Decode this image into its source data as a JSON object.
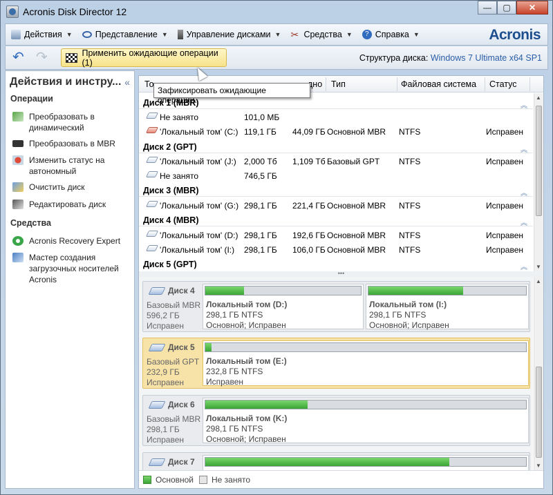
{
  "window": {
    "title": "Acronis Disk Director 12",
    "buttons": [
      "—",
      "▢",
      "✕"
    ]
  },
  "menu": {
    "items": [
      "Действия",
      "Представление",
      "Управление дисками",
      "Средства",
      "Справка"
    ],
    "logo": "Acronis"
  },
  "toolbar": {
    "apply_label": "Применить ожидающие операции (1)",
    "structure_label": "Структура диска:",
    "structure_value": "Windows 7 Ultimate x64 SP1"
  },
  "tooltip": "Зафиксировать ожидающие операции.",
  "left_panel": {
    "title": "Действия и инстру...",
    "collapse": "«",
    "operations_title": "Операции",
    "operations": [
      "Преобразовать в динамический",
      "Преобразовать в MBR",
      "Изменить статус на автономный",
      "Очистить диск",
      "Редактировать диск"
    ],
    "tools_title": "Средства",
    "tools": [
      "Acronis Recovery Expert",
      "Мастер создания загрузочных носителей Acronis"
    ]
  },
  "table": {
    "headers": {
      "tom": "То",
      "free": "дно",
      "type": "Тип",
      "fs": "Файловая система",
      "status": "Статус"
    },
    "groups": [
      {
        "name": "Диск 1 (MBR)",
        "rows": [
          {
            "volume": "Не занято",
            "capacity": "101,0 МБ",
            "free": "",
            "type": "",
            "fs": "",
            "status": ""
          },
          {
            "volume": "'Локальный том' (C:)",
            "capacity": "119,1 ГБ",
            "free": "44,09 ГБ",
            "type": "Основной MBR",
            "fs": "NTFS",
            "status": "Исправен"
          }
        ]
      },
      {
        "name": "Диск 2 (GPT)",
        "rows": [
          {
            "volume": "'Локальный том' (J:)",
            "capacity": "2,000 Тб",
            "free": "1,109 Тб",
            "type": "Базовый GPT",
            "fs": "NTFS",
            "status": "Исправен"
          },
          {
            "volume": "Не занято",
            "capacity": "746,5 ГБ",
            "free": "",
            "type": "",
            "fs": "",
            "status": ""
          }
        ]
      },
      {
        "name": "Диск 3 (MBR)",
        "rows": [
          {
            "volume": "'Локальный том' (G:)",
            "capacity": "298,1 ГБ",
            "free": "221,4 ГБ",
            "type": "Основной MBR",
            "fs": "NTFS",
            "status": "Исправен"
          }
        ]
      },
      {
        "name": "Диск 4 (MBR)",
        "rows": [
          {
            "volume": "'Локальный том' (D:)",
            "capacity": "298,1 ГБ",
            "free": "192,6 ГБ",
            "type": "Основной MBR",
            "fs": "NTFS",
            "status": "Исправен"
          },
          {
            "volume": "'Локальный том' (I:)",
            "capacity": "298,1 ГБ",
            "free": "106,0 ГБ",
            "type": "Основной MBR",
            "fs": "NTFS",
            "status": "Исправен"
          }
        ]
      },
      {
        "name": "Диск 5 (GPT)",
        "rows": []
      }
    ]
  },
  "splitter": "•••",
  "disks": [
    {
      "name": "Диск 4",
      "kind": "Базовый MBR",
      "size": "596,2 ГБ",
      "status": "Исправен",
      "selected": false,
      "parts": [
        {
          "label": "Локальный том (D:)",
          "info": "298,1 ГБ NTFS",
          "state": "Основной; Исправен",
          "used": 0.25
        },
        {
          "label": "Локальный том (I:)",
          "info": "298,1 ГБ NTFS",
          "state": "Основной; Исправен",
          "used": 0.6
        }
      ]
    },
    {
      "name": "Диск 5",
      "kind": "Базовый GPT",
      "size": "232,9 ГБ",
      "status": "Исправен",
      "selected": true,
      "parts": [
        {
          "label": "Локальный том (E:)",
          "info": "232,8 ГБ NTFS",
          "state": "Исправен",
          "used": 0.02
        }
      ]
    },
    {
      "name": "Диск 6",
      "kind": "Базовый MBR",
      "size": "298,1 ГБ",
      "status": "Исправен",
      "selected": false,
      "parts": [
        {
          "label": "Локальный том (K:)",
          "info": "298,1 ГБ NTFS",
          "state": "Основной; Исправен",
          "used": 0.32
        }
      ]
    },
    {
      "name": "Диск 7",
      "kind": "",
      "size": "",
      "status": "",
      "selected": false,
      "parts": [
        {
          "label": "",
          "info": "",
          "state": "",
          "used": 0.76
        }
      ]
    }
  ],
  "legend": {
    "primary": "Основной",
    "free": "Не занято"
  },
  "colors": {
    "primary": "#4bb445",
    "accent": "#1d4f8f",
    "selected": "#f7e2a8"
  }
}
